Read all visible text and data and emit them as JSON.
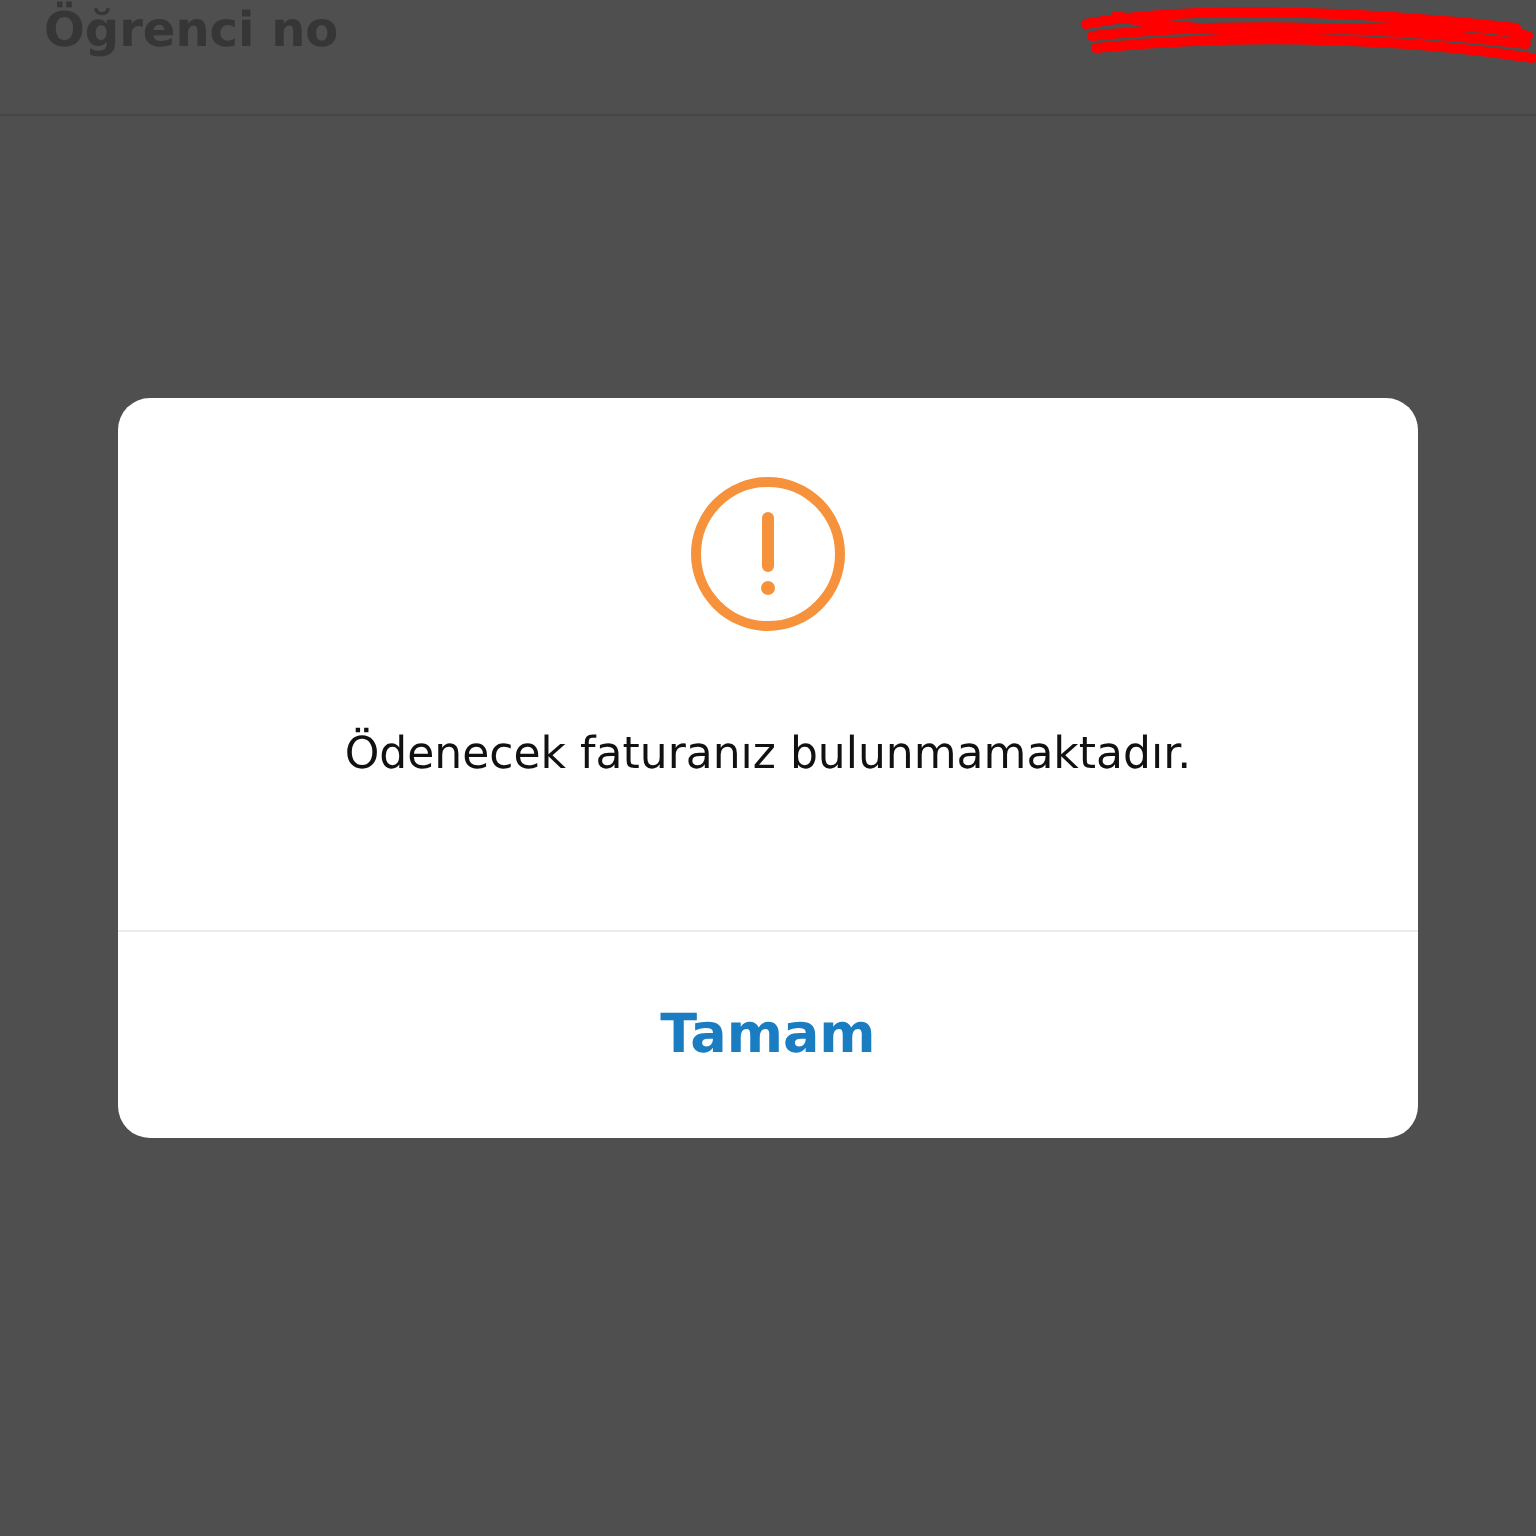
{
  "header": {
    "label": "Öğrenci no"
  },
  "dialog": {
    "kind": "warning",
    "message": "Ödenecek faturanız bulunmamaktadır.",
    "buttons": [
      "Tamam"
    ]
  }
}
